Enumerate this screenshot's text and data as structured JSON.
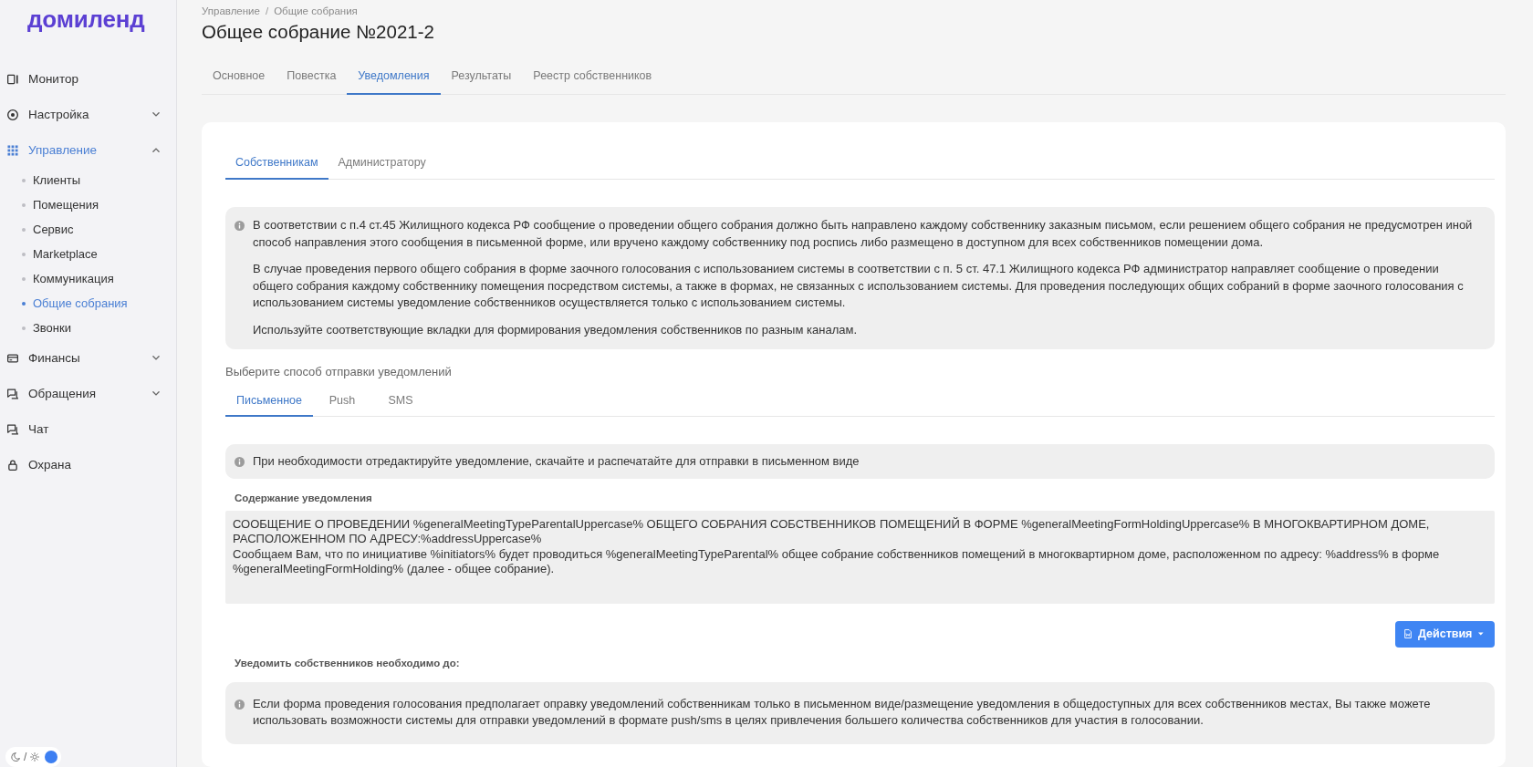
{
  "sidebar": {
    "logo": "домиленд",
    "items": [
      {
        "label": "Монитор",
        "kind": "link",
        "selected": false
      },
      {
        "label": "Настройка",
        "kind": "group",
        "expanded": false,
        "selected": false
      },
      {
        "label": "Управление",
        "kind": "group",
        "expanded": true,
        "selected": true,
        "children": [
          {
            "label": "Клиенты",
            "selected": false
          },
          {
            "label": "Помещения",
            "selected": false
          },
          {
            "label": "Сервис",
            "selected": false
          },
          {
            "label": "Marketplace",
            "selected": false
          },
          {
            "label": "Коммуникация",
            "selected": false
          },
          {
            "label": "Общие собрания",
            "selected": true
          },
          {
            "label": "Звонки",
            "selected": false
          }
        ]
      },
      {
        "label": "Финансы",
        "kind": "group",
        "expanded": false,
        "selected": false
      },
      {
        "label": "Обращения",
        "kind": "group",
        "expanded": false,
        "selected": false
      },
      {
        "label": "Чат",
        "kind": "link",
        "selected": false
      },
      {
        "label": "Охрана",
        "kind": "link",
        "selected": false
      }
    ],
    "theme_switch": {
      "separator": "/",
      "dark_mode": false
    }
  },
  "breadcrumb": {
    "items": [
      "Управление",
      "Общие собрания"
    ],
    "separator": "/"
  },
  "title": "Общее собрание №2021-2",
  "tabs": [
    {
      "label": "Основное",
      "selected": false
    },
    {
      "label": "Повестка",
      "selected": false
    },
    {
      "label": "Уведомления",
      "selected": true
    },
    {
      "label": "Результаты",
      "selected": false
    },
    {
      "label": "Реестр собственников",
      "selected": false
    }
  ],
  "card": {
    "recipient_tabs": [
      {
        "label": "Собственникам",
        "selected": true
      },
      {
        "label": "Администратору",
        "selected": false
      }
    ],
    "info": [
      "В соответствии с п.4 ст.45 Жилищного кодекса РФ сообщение о проведении общего собрания должно быть направлено каждому собственнику заказным письмом, если решением общего собрания не предусмотрен иной способ направления этого сообщения в письменной форме, или вручено каждому собственнику под роспись либо размещено в доступном для всех собственников помещении дома.",
      "В случае проведения первого общего собрания в форме заочного голосования с использованием системы в соответствии с п. 5 ст. 47.1 Жилищного кодекса РФ администратор направляет сообщение о проведении общего собрания каждому собственнику помещения посредством системы, а также в формах, не связанных с использованием системы. Для проведения последующих общих собраний в форме заочного голосования с использованием системы уведомление собственников осуществляется только с использованием системы.",
      "Используйте соответствующие вкладки для формирования уведомления собственников по разным каналам."
    ],
    "channel_label": "Выберите способ отправки уведомлений",
    "channel_tabs": [
      {
        "label": "Письменное",
        "selected": true
      },
      {
        "label": "Push",
        "selected": false
      },
      {
        "label": "SMS",
        "selected": false
      }
    ],
    "hint": "При необходимости отредактируйте уведомление, скачайте и распечатайте для отправки в письменном виде",
    "content": {
      "label": "Содержание уведомления",
      "value": "СООБЩЕНИЕ О ПРОВЕДЕНИИ %generalMeetingTypeParentalUppercase% ОБЩЕГО СОБРАНИЯ СОБСТВЕННИКОВ ПОМЕЩЕНИЙ В ФОРМЕ %generalMeetingFormHoldingUppercase% В МНОГОКВАРТИРНОМ ДОМЕ, РАСПОЛОЖЕННОМ ПО АДРЕСУ:%addressUppercase%\nСообщаем Вам, что по инициативе %initiators% будет проводиться %generalMeetingTypeParental% общее собрание собственников помещений в многоквартирном доме, расположенном по адресу: %address% в форме %generalMeetingFormHolding% (далее - общее собрание)."
    },
    "actions_button": "Действия",
    "deadline_label": "Уведомить собственников необходимо до:",
    "note": "Если форма проведения голосования предполагает оправку уведомлений собственникам только в письменном виде/размещение уведомления в общедоступных для всех собственников местах, Вы также можете использовать возможности системы для отправки уведомлений в формате push/sms в целях привлечения большего количества собственников для участия в голосовании."
  }
}
